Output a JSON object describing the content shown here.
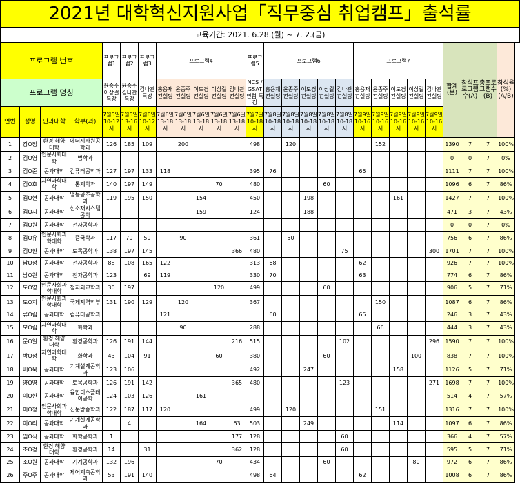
{
  "title": "2021년 대학혁신지원사업「직무중심 취업캠프」출석률",
  "period": "교육기간: 2021. 6.28.(월) ~ 7. 2.(금)",
  "header": {
    "program_no": "프로그램 번호",
    "program_name": "프로그램 명칭",
    "col_no": "연번",
    "col_name": "성명",
    "col_college": "단과대학",
    "col_dept": "학부(과)",
    "total": "합계(분)",
    "attended": "참석프로그램수(A)",
    "all_prog": "총프로그램수(B)",
    "rate": "참석율(%)(A/B)"
  },
  "programs": [
    {
      "group": "프로그램1",
      "name": "윤종주 이상걸 특강",
      "date": "7월5일 10-12시"
    },
    {
      "group": "프로그램2",
      "name": "윤종주 김나관 특강",
      "date": "7월5일 13-16시"
    },
    {
      "group": "프로그램3",
      "name": "김나관 특강",
      "date": "7월6일 10-12시"
    },
    {
      "group": "프로그램4",
      "name": "홍용재 컨설팅",
      "date": "7월6일 13-18시"
    },
    {
      "group": "프로그램4",
      "name": "윤종주 컨설팅",
      "date": "7월6일 13-18시"
    },
    {
      "group": "프로그램4",
      "name": "이도경 컨설팅",
      "date": "7월6일 13-18시"
    },
    {
      "group": "프로그램4",
      "name": "이상걸 컨설팅",
      "date": "7월6일 13-18시"
    },
    {
      "group": "프로그램4",
      "name": "김나관 컨설팅",
      "date": "7월6일 13-18시"
    },
    {
      "group": "프로그램5",
      "name": "NCS / GSAT 면접 특강",
      "date": "7월7일 10-18시"
    },
    {
      "group": "프로그램6",
      "name": "홍용재 컨설팅",
      "date": "7월8일 10-18시"
    },
    {
      "group": "프로그램6",
      "name": "윤종주 컨설팅",
      "date": "7월8일 10-18시"
    },
    {
      "group": "프로그램6",
      "name": "이도경 컨설팅",
      "date": "7월8일 10-18시"
    },
    {
      "group": "프로그램6",
      "name": "이상걸 컨설팅",
      "date": "7월8일 10-18시"
    },
    {
      "group": "프로그램6",
      "name": "김나관 컨설팅",
      "date": "7월8일 10-18시"
    },
    {
      "group": "프로그램7",
      "name": "홍용재 컨설팅",
      "date": "7월9일 10-16시"
    },
    {
      "group": "프로그램7",
      "name": "윤종주 컨설팅",
      "date": "7월9일 10-16시"
    },
    {
      "group": "프로그램7",
      "name": "이도경 컨설팅",
      "date": "7월9일 10-16시"
    },
    {
      "group": "프로그램7",
      "name": "이상걸 컨설팅",
      "date": "7월9일 10-16시"
    },
    {
      "group": "프로그램7",
      "name": "김나관 컨설팅",
      "date": "7월9일 10-16시"
    }
  ],
  "group_labels": {
    "p1": "프로그램1",
    "p2": "프로그램2",
    "p3": "프로그램3",
    "p4": "프로그램4",
    "p5": "프로그램5",
    "p6": "프로그램6",
    "p7": "프로그램7"
  },
  "rows": [
    {
      "no": "1",
      "name": "강O정",
      "college": "환경·해양대학",
      "dept": "에너지자원공학과",
      "v": [
        "126",
        "185",
        "109",
        "",
        "200",
        "",
        "",
        "",
        "498",
        "",
        "120",
        "",
        "",
        "",
        "",
        "152",
        "",
        "",
        ""
      ],
      "total": "1390",
      "a": "7",
      "b": "7",
      "rate": "100%"
    },
    {
      "no": "2",
      "name": "김O영",
      "college": "인문사회대학",
      "dept": "법학과",
      "v": [
        "",
        "",
        "",
        "",
        "",
        "",
        "",
        "",
        "",
        "",
        "",
        "",
        "",
        "",
        "",
        "",
        "",
        "",
        ""
      ],
      "total": "0",
      "a": "0",
      "b": "7",
      "rate": "0%"
    },
    {
      "no": "3",
      "name": "김O준",
      "college": "공과대학",
      "dept": "컴퓨터공학과",
      "v": [
        "127",
        "197",
        "133",
        "118",
        "",
        "",
        "",
        "",
        "395",
        "76",
        "",
        "",
        "",
        "",
        "65",
        "",
        "",
        "",
        ""
      ],
      "total": "1111",
      "a": "7",
      "b": "7",
      "rate": "100%"
    },
    {
      "no": "4",
      "name": "김O호",
      "college": "자연과학대학",
      "dept": "통계학과",
      "v": [
        "140",
        "197",
        "149",
        "",
        "",
        "",
        "70",
        "",
        "480",
        "",
        "",
        "",
        "60",
        "",
        "",
        "",
        "",
        "",
        ""
      ],
      "total": "1096",
      "a": "6",
      "b": "7",
      "rate": "86%"
    },
    {
      "no": "5",
      "name": "김O현",
      "college": "공과대학",
      "dept": "냉동공조공학과",
      "v": [
        "119",
        "195",
        "150",
        "",
        "",
        "154",
        "",
        "",
        "450",
        "",
        "",
        "198",
        "",
        "",
        "",
        "",
        "161",
        "",
        ""
      ],
      "total": "1427",
      "a": "7",
      "b": "7",
      "rate": "100%"
    },
    {
      "no": "6",
      "name": "김O지",
      "college": "공과대학",
      "dept": "신소재시스템공학",
      "v": [
        "",
        "",
        "",
        "",
        "",
        "159",
        "",
        "",
        "124",
        "",
        "",
        "188",
        "",
        "",
        "",
        "",
        "",
        "",
        ""
      ],
      "total": "471",
      "a": "3",
      "b": "7",
      "rate": "43%"
    },
    {
      "no": "7",
      "name": "김O원",
      "college": "공과대학",
      "dept": "전자공학과",
      "v": [
        "",
        "",
        "",
        "",
        "",
        "",
        "",
        "",
        "",
        "",
        "",
        "",
        "",
        "",
        "",
        "",
        "",
        "",
        ""
      ],
      "total": "0",
      "a": "0",
      "b": "7",
      "rate": "0%"
    },
    {
      "no": "8",
      "name": "김O유",
      "college": "인문사회과학대학",
      "dept": "중국학과",
      "v": [
        "117",
        "79",
        "59",
        "",
        "90",
        "",
        "",
        "",
        "361",
        "",
        "50",
        "",
        "",
        "",
        "",
        "",
        "",
        "",
        ""
      ],
      "total": "756",
      "a": "6",
      "b": "7",
      "rate": "86%"
    },
    {
      "no": "9",
      "name": "김O환",
      "college": "공과대학",
      "dept": "토목공학과",
      "v": [
        "138",
        "197",
        "145",
        "",
        "",
        "",
        "",
        "366",
        "480",
        "",
        "",
        "",
        "",
        "75",
        "",
        "",
        "",
        "",
        "300"
      ],
      "total": "1701",
      "a": "7",
      "b": "7",
      "rate": "100%"
    },
    {
      "no": "10",
      "name": "남O정",
      "college": "공과대학",
      "dept": "전자공학과",
      "v": [
        "88",
        "108",
        "165",
        "122",
        "",
        "",
        "",
        "",
        "313",
        "68",
        "",
        "",
        "",
        "",
        "62",
        "",
        "",
        "",
        ""
      ],
      "total": "926",
      "a": "7",
      "b": "7",
      "rate": "100%"
    },
    {
      "no": "11",
      "name": "남O원",
      "college": "공과대학",
      "dept": "전자공학과",
      "v": [
        "123",
        "",
        "69",
        "119",
        "",
        "",
        "",
        "",
        "330",
        "70",
        "",
        "",
        "",
        "",
        "63",
        "",
        "",
        "",
        ""
      ],
      "total": "774",
      "a": "6",
      "b": "7",
      "rate": "86%"
    },
    {
      "no": "12",
      "name": "도O영",
      "college": "인문사회과학대학",
      "dept": "정치외교학과",
      "v": [
        "30",
        "197",
        "",
        "",
        "",
        "",
        "120",
        "",
        "499",
        "",
        "",
        "",
        "60",
        "",
        "",
        "",
        "",
        "",
        ""
      ],
      "total": "906",
      "a": "5",
      "b": "7",
      "rate": "71%"
    },
    {
      "no": "13",
      "name": "도O지",
      "college": "인문사회과학대학",
      "dept": "국제지역학부",
      "v": [
        "131",
        "190",
        "129",
        "",
        "120",
        "",
        "",
        "",
        "367",
        "",
        "",
        "",
        "",
        "",
        "",
        "150",
        "",
        "",
        ""
      ],
      "total": "1087",
      "a": "6",
      "b": "7",
      "rate": "86%"
    },
    {
      "no": "14",
      "name": "류O림",
      "college": "공과대학",
      "dept": "컴퓨터공학과",
      "v": [
        "",
        "",
        "",
        "121",
        "",
        "",
        "",
        "",
        "",
        "60",
        "",
        "",
        "",
        "",
        "65",
        "",
        "",
        "",
        ""
      ],
      "total": "246",
      "a": "3",
      "b": "7",
      "rate": "43%"
    },
    {
      "no": "15",
      "name": "모O림",
      "college": "자연과학대학",
      "dept": "화학과",
      "v": [
        "",
        "",
        "",
        "",
        "90",
        "",
        "",
        "",
        "288",
        "",
        "",
        "",
        "",
        "",
        "",
        "66",
        "",
        "",
        ""
      ],
      "total": "444",
      "a": "3",
      "b": "7",
      "rate": "43%"
    },
    {
      "no": "16",
      "name": "문O일",
      "college": "환경·해양대학",
      "dept": "환경공학과",
      "v": [
        "126",
        "191",
        "144",
        "",
        "",
        "",
        "",
        "216",
        "515",
        "",
        "",
        "",
        "",
        "102",
        "",
        "",
        "",
        "",
        "296"
      ],
      "total": "1590",
      "a": "7",
      "b": "7",
      "rate": "100%"
    },
    {
      "no": "17",
      "name": "박O정",
      "college": "자연과학대학",
      "dept": "화학과",
      "v": [
        "43",
        "104",
        "91",
        "",
        "",
        "",
        "60",
        "",
        "380",
        "",
        "",
        "",
        "60",
        "",
        "",
        "",
        "",
        "100",
        ""
      ],
      "total": "838",
      "a": "7",
      "b": "7",
      "rate": "100%"
    },
    {
      "no": "18",
      "name": "배O욱",
      "college": "공과대학",
      "dept": "기계설계공학과",
      "v": [
        "123",
        "106",
        "",
        "",
        "",
        "",
        "",
        "",
        "492",
        "",
        "",
        "247",
        "",
        "",
        "",
        "",
        "158",
        "",
        ""
      ],
      "total": "1126",
      "a": "5",
      "b": "7",
      "rate": "71%"
    },
    {
      "no": "19",
      "name": "양O영",
      "college": "공과대학",
      "dept": "토목공학과",
      "v": [
        "126",
        "191",
        "142",
        "",
        "",
        "",
        "",
        "365",
        "480",
        "",
        "",
        "",
        "",
        "123",
        "",
        "",
        "",
        "",
        "271"
      ],
      "total": "1698",
      "a": "7",
      "b": "7",
      "rate": "100%"
    },
    {
      "no": "20",
      "name": "이O한",
      "college": "공과대학",
      "dept": "융합디스플레이공학",
      "v": [
        "124",
        "103",
        "126",
        "",
        "",
        "161",
        "",
        "",
        "",
        "",
        "",
        "",
        "",
        "",
        "",
        "",
        "",
        "",
        ""
      ],
      "total": "514",
      "a": "4",
      "b": "7",
      "rate": "57%"
    },
    {
      "no": "21",
      "name": "이O정",
      "college": "인문사회과학대학",
      "dept": "신문방송학과",
      "v": [
        "122",
        "187",
        "117",
        "120",
        "",
        "",
        "",
        "",
        "499",
        "",
        "120",
        "",
        "",
        "",
        "",
        "151",
        "",
        "",
        ""
      ],
      "total": "1316",
      "a": "7",
      "b": "7",
      "rate": "100%"
    },
    {
      "no": "22",
      "name": "이O리",
      "college": "공과대학",
      "dept": "기계설계공학과",
      "v": [
        "",
        "4",
        "",
        "",
        "",
        "164",
        "",
        "63",
        "503",
        "",
        "",
        "249",
        "",
        "",
        "",
        "",
        "114",
        "",
        ""
      ],
      "total": "1097",
      "a": "6",
      "b": "7",
      "rate": "86%"
    },
    {
      "no": "23",
      "name": "임O식",
      "college": "공과대학",
      "dept": "화학공학과",
      "v": [
        "1",
        "",
        "",
        "",
        "",
        "",
        "",
        "177",
        "128",
        "",
        "",
        "",
        "",
        "60",
        "",
        "",
        "",
        "",
        ""
      ],
      "total": "366",
      "a": "4",
      "b": "7",
      "rate": "57%"
    },
    {
      "no": "24",
      "name": "조O경",
      "college": "환경·해양대학",
      "dept": "환경공학과",
      "v": [
        "14",
        "",
        "31",
        "",
        "",
        "",
        "",
        "362",
        "128",
        "",
        "",
        "",
        "",
        "60",
        "",
        "",
        "",
        "",
        ""
      ],
      "total": "595",
      "a": "5",
      "b": "7",
      "rate": "71%"
    },
    {
      "no": "25",
      "name": "조O원",
      "college": "공과대학",
      "dept": "기계공학과",
      "v": [
        "132",
        "196",
        "",
        "",
        "",
        "",
        "70",
        "",
        "434",
        "",
        "",
        "",
        "60",
        "",
        "",
        "",
        "",
        "80",
        ""
      ],
      "total": "972",
      "a": "6",
      "b": "7",
      "rate": "86%"
    },
    {
      "no": "26",
      "name": "주O주",
      "college": "공과대학",
      "dept": "제어계측공학과",
      "v": [
        "53",
        "191",
        "140",
        "",
        "",
        "",
        "",
        "",
        "498",
        "64",
        "",
        "",
        "",
        "",
        "62",
        "",
        "",
        "",
        ""
      ],
      "total": "1008",
      "a": "6",
      "b": "7",
      "rate": "86%"
    }
  ]
}
